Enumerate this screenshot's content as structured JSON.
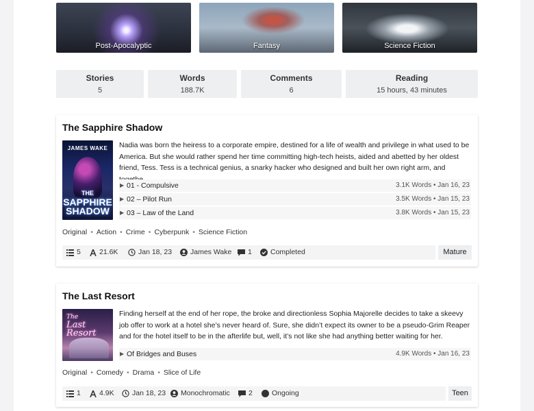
{
  "genres": [
    {
      "label": "Post-Apocalyptic",
      "icon": "genre-image"
    },
    {
      "label": "Fantasy",
      "icon": "genre-image"
    },
    {
      "label": "Science Fiction",
      "icon": "genre-image"
    }
  ],
  "stats": [
    {
      "label": "Stories",
      "value": "5"
    },
    {
      "label": "Words",
      "value": "188.7K"
    },
    {
      "label": "Comments",
      "value": "6"
    },
    {
      "label": "Reading",
      "value": "15 hours, 43 minutes"
    }
  ],
  "stories": [
    {
      "title": "The Sapphire Shadow",
      "cover": {
        "author": "JAMES WAKE",
        "title_line1": "THE",
        "title_line2": "SAPPHIRE",
        "title_line3": "SHADOW"
      },
      "description": "Nadia was born the heiress to a corporate empire, destined for a life of wealth and privilege in what used to be America. But she would rather spend her time committing high-tech heists, aided and abetted by her oldest friend, Tess. Tess is a technical genius, a snarky hacker who designed and built her own right arm, and togethe…",
      "chapters": [
        {
          "name": "01 - Compulsive",
          "words": "3.1K Words",
          "date": "Jan 16, 23"
        },
        {
          "name": "02 – Pilot Run",
          "words": "3.5K Words",
          "date": "Jan 15, 23"
        },
        {
          "name": "03 – Law of the Land",
          "words": "3.8K Words",
          "date": "Jan 15, 23"
        }
      ],
      "tags": [
        "Original",
        "Action",
        "Crime",
        "Cyberpunk",
        "Science Fiction"
      ],
      "footer": {
        "chapters": "5",
        "words": "21.6K",
        "updated": "Jan 18, 23",
        "author": "James Wake",
        "comments": "1",
        "status": "Completed"
      },
      "rating": "Mature"
    },
    {
      "title": "The Last Resort",
      "cover": {
        "title_line1": "The",
        "title_line2": "Last",
        "title_line3": "Resort"
      },
      "description": "Finding herself at the end of her rope, the broke and directionless Sophia Majorelle decides to take a skeevy job offer to work at a hotel she’s never heard of. Sure, she didn’t expect its owner to be a pseudo-Grim Reaper and for the hotel itself to be in the afterlife but, well, it’s not like she had anything better waiting for her.",
      "chapters": [
        {
          "name": "Of Bridges and Buses",
          "words": "4.9K Words",
          "date": "Jan 16, 23"
        }
      ],
      "tags": [
        "Original",
        "Comedy",
        "Drama",
        "Slice of Life"
      ],
      "footer": {
        "chapters": "1",
        "words": "4.9K",
        "updated": "Jan 18, 23",
        "author": "Monochromatic",
        "comments": "2",
        "status": "Ongoing"
      },
      "rating": "Teen"
    }
  ],
  "separator": "•",
  "chapter_marker": "▶"
}
